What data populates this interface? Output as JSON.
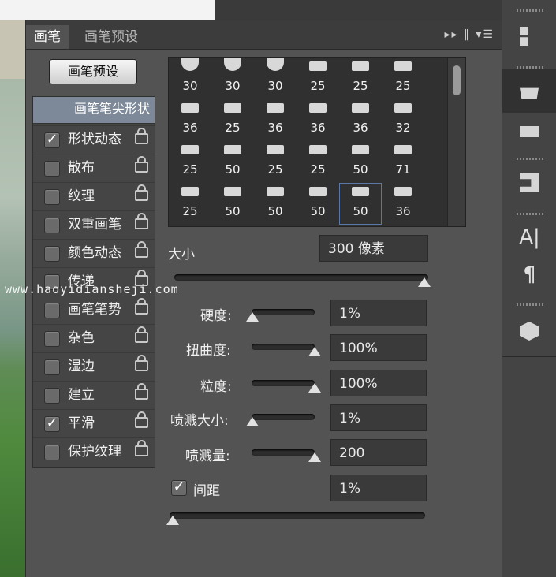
{
  "tabs": [
    "画笔",
    "画笔预设"
  ],
  "preset_button": "画笔预设",
  "brush_tip_shape": "画笔笔尖形状",
  "options": [
    {
      "label": "形状动态",
      "checked": true
    },
    {
      "label": "散布",
      "checked": false
    },
    {
      "label": "纹理",
      "checked": false
    },
    {
      "label": "双重画笔",
      "checked": false
    },
    {
      "label": "颜色动态",
      "checked": false
    },
    {
      "label": "传递",
      "checked": false
    },
    {
      "label": "画笔笔势",
      "checked": false
    },
    {
      "label": "杂色",
      "checked": false
    },
    {
      "label": "湿边",
      "checked": false
    },
    {
      "label": "建立",
      "checked": false
    },
    {
      "label": "平滑",
      "checked": true
    },
    {
      "label": "保护纹理",
      "checked": false
    }
  ],
  "brush_sizes": [
    [
      "30",
      "30",
      "30",
      "25",
      "25",
      "25"
    ],
    [
      "36",
      "25",
      "36",
      "36",
      "36",
      "32"
    ],
    [
      "25",
      "50",
      "25",
      "25",
      "50",
      "71"
    ],
    [
      "25",
      "50",
      "50",
      "50",
      "50",
      "36"
    ]
  ],
  "size": {
    "label": "大小",
    "value": "300 像素"
  },
  "hardness": {
    "label": "硬度:",
    "value": "1%",
    "level": 0.01
  },
  "distortion": {
    "label": "扭曲度:",
    "value": "100%",
    "level": 1.0
  },
  "grain": {
    "label": "粒度:",
    "value": "100%",
    "level": 1.0
  },
  "spatter_size": {
    "label": "喷溅大小:",
    "value": "1%",
    "level": 0.01
  },
  "spatter_amount": {
    "label": "喷溅量:",
    "value": "200",
    "level": 1.0
  },
  "spacing": {
    "label": "间距",
    "value": "1%",
    "checked": true
  },
  "watermark": "www.haoyidiansheji.com",
  "right_tools": [
    "A|",
    "¶"
  ]
}
